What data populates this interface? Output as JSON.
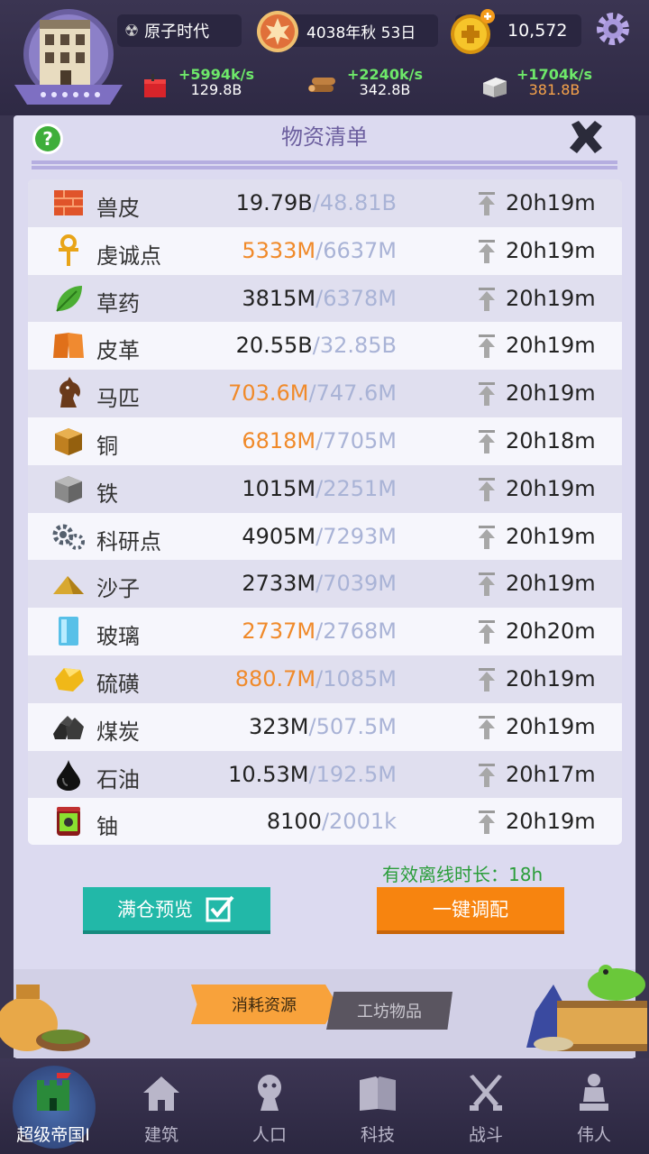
{
  "header": {
    "era": "原子时代",
    "date": "4038年秋 53日",
    "gold": "10,572",
    "resources": [
      {
        "icon": "red-crate-icon",
        "rate": "+5994k/s",
        "total": "129.8B",
        "warn": false
      },
      {
        "icon": "wood-logs-icon",
        "rate": "+2240k/s",
        "total": "342.8B",
        "warn": false
      },
      {
        "icon": "stone-block-icon",
        "rate": "+1704k/s",
        "total": "381.8B",
        "warn": true
      }
    ]
  },
  "panel": {
    "title": "物资清单",
    "offline_label": "有效离线时长：18h",
    "btn_full_preview": "满仓预览",
    "btn_auto_assign": "一键调配",
    "tab_consume": "消耗资源",
    "tab_workshop": "工坊物品"
  },
  "items": [
    {
      "icon": "brick-icon",
      "name": "兽皮",
      "cur": "19.79B",
      "cap": "/48.81B",
      "full": false,
      "time": "20h19m"
    },
    {
      "icon": "ankh-icon",
      "name": "虔诚点",
      "cur": "5333M",
      "cap": "/6637M",
      "full": true,
      "time": "20h19m"
    },
    {
      "icon": "herb-leaf-icon",
      "name": "草药",
      "cur": "3815M",
      "cap": "/6378M",
      "full": false,
      "time": "20h19m"
    },
    {
      "icon": "leather-icon",
      "name": "皮革",
      "cur": "20.55B",
      "cap": "/32.85B",
      "full": false,
      "time": "20h19m"
    },
    {
      "icon": "horse-icon",
      "name": "马匹",
      "cur": "703.6M",
      "cap": "/747.6M",
      "full": true,
      "time": "20h19m"
    },
    {
      "icon": "copper-cube-icon",
      "name": "铜",
      "cur": "6818M",
      "cap": "/7705M",
      "full": true,
      "time": "20h18m"
    },
    {
      "icon": "iron-cube-icon",
      "name": "铁",
      "cur": "1015M",
      "cap": "/2251M",
      "full": false,
      "time": "20h19m"
    },
    {
      "icon": "gears-icon",
      "name": "科研点",
      "cur": "4905M",
      "cap": "/7293M",
      "full": false,
      "time": "20h19m"
    },
    {
      "icon": "sand-pile-icon",
      "name": "沙子",
      "cur": "2733M",
      "cap": "/7039M",
      "full": false,
      "time": "20h19m"
    },
    {
      "icon": "glass-icon",
      "name": "玻璃",
      "cur": "2737M",
      "cap": "/2768M",
      "full": true,
      "time": "20h20m"
    },
    {
      "icon": "sulfur-icon",
      "name": "硫磺",
      "cur": "880.7M",
      "cap": "/1085M",
      "full": true,
      "time": "20h19m"
    },
    {
      "icon": "coal-icon",
      "name": "煤炭",
      "cur": "323M",
      "cap": "/507.5M",
      "full": false,
      "time": "20h19m"
    },
    {
      "icon": "oil-drop-icon",
      "name": "石油",
      "cur": "10.53M",
      "cap": "/192.5M",
      "full": false,
      "time": "20h17m"
    },
    {
      "icon": "uranium-barrel-icon",
      "name": "铀",
      "cur": "8100",
      "cap": "/2001k",
      "full": false,
      "time": "20h19m"
    }
  ],
  "nav": [
    {
      "icon": "castle-icon",
      "label": "超级帝国I",
      "active": true
    },
    {
      "icon": "house-icon",
      "label": "建筑",
      "active": false
    },
    {
      "icon": "person-icon",
      "label": "人口",
      "active": false
    },
    {
      "icon": "book-icon",
      "label": "科技",
      "active": false
    },
    {
      "icon": "swords-icon",
      "label": "战斗",
      "active": false
    },
    {
      "icon": "statue-icon",
      "label": "伟人",
      "active": false
    }
  ],
  "colors": {
    "accent_orange": "#f08a2a",
    "teal_button": "#22b8a8",
    "orange_button": "#f7840f",
    "rate_green": "#6ee86a"
  }
}
